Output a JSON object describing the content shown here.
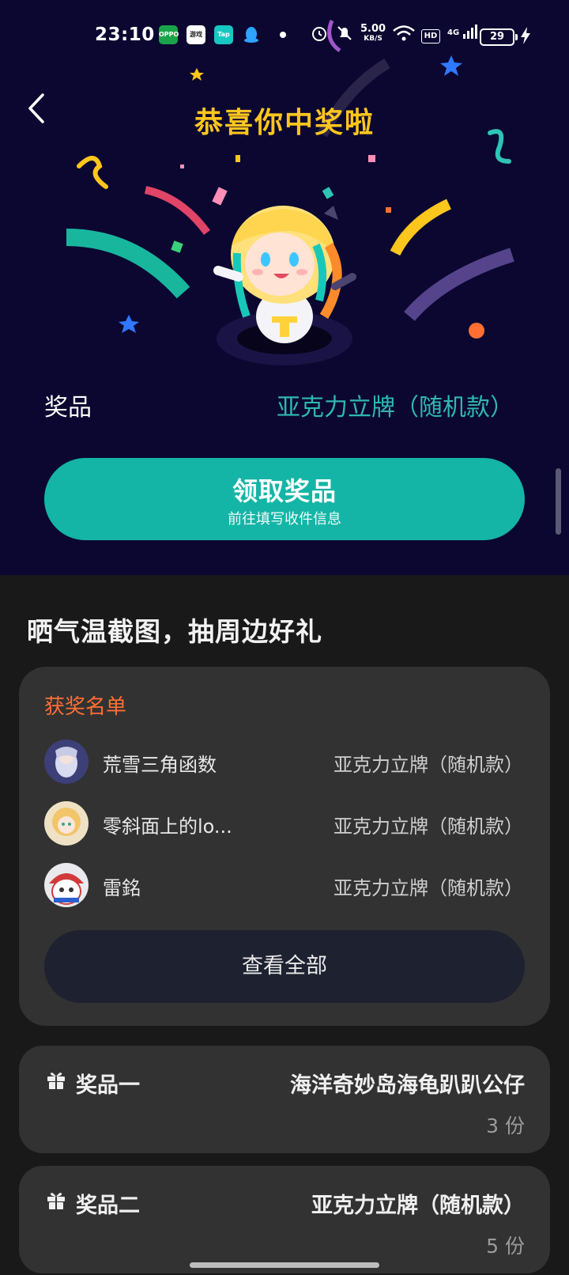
{
  "status_bar": {
    "time": "23:10",
    "app_icons": [
      "oppo-icon",
      "game-center-icon",
      "tap-icon",
      "qq-icon"
    ],
    "net_speed": "5.00",
    "net_speed_unit": "KB/S",
    "hd": "HD",
    "signal": "4G",
    "battery": "29"
  },
  "header": {
    "title": "恭喜你中奖啦",
    "prize_label": "奖品",
    "prize_value": "亚克力立牌（随机款）"
  },
  "claim_button": {
    "label": "领取奖品",
    "sublabel": "前往填写收件信息"
  },
  "campaign": {
    "title": "晒气温截图，抽周边好礼"
  },
  "winners": {
    "title": "获奖名单",
    "rows": [
      {
        "name": "荒雪三角函数",
        "prize": "亚克力立牌（随机款）"
      },
      {
        "name": "零斜面上的lo...",
        "prize": "亚克力立牌（随机款）"
      },
      {
        "name": "雷銘",
        "prize": "亚克力立牌（随机款）"
      }
    ],
    "view_all": "查看全部"
  },
  "prizes": [
    {
      "label": "奖品一",
      "name": "海洋奇妙岛海龟趴趴公仔",
      "qty": "3 份"
    },
    {
      "label": "奖品二",
      "name": "亚克力立牌（随机款）",
      "qty": "5 份"
    }
  ],
  "colors": {
    "hero_bg": "#0b0731",
    "title": "#ffc61e",
    "accent_teal": "#14b5a6",
    "winners_title": "#ff6f34"
  }
}
